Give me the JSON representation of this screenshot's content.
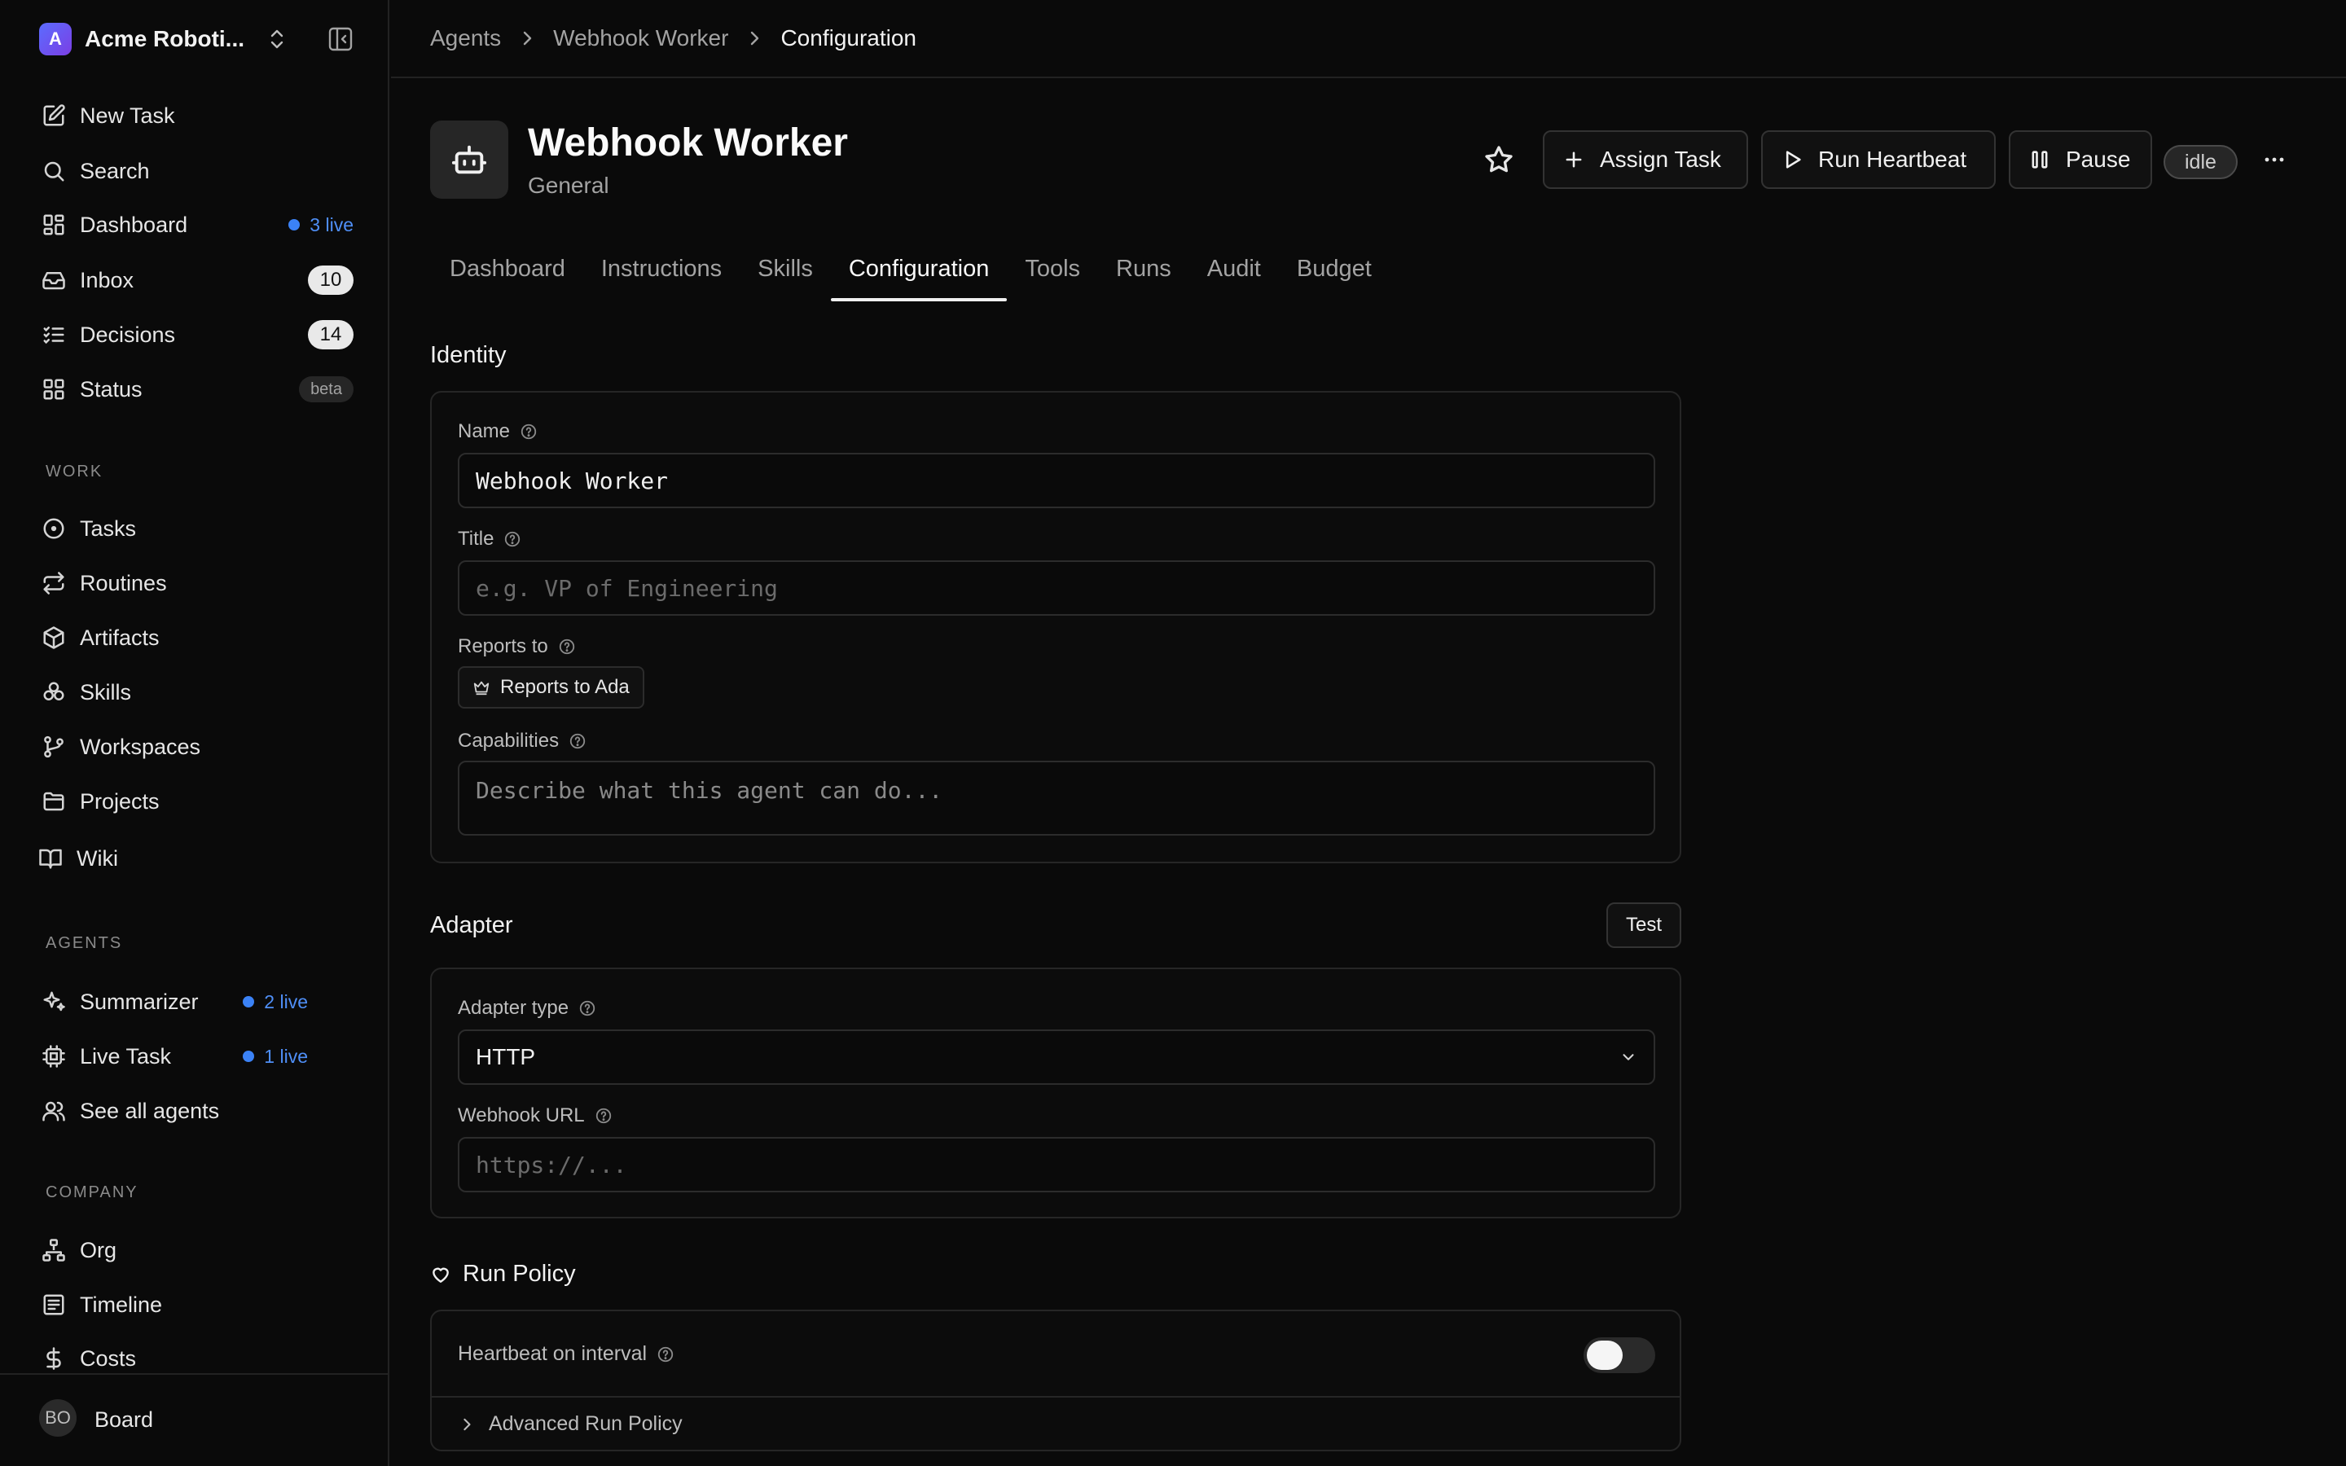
{
  "workspace": {
    "name": "Acme Roboti...",
    "logo_letter": "A"
  },
  "nav": {
    "new_task": "New Task",
    "search": "Search",
    "dashboard": "Dashboard",
    "dashboard_live": "3 live",
    "inbox": "Inbox",
    "inbox_count": "10",
    "decisions": "Decisions",
    "decisions_count": "14",
    "status": "Status",
    "status_badge": "beta"
  },
  "work": {
    "label": "WORK",
    "items": [
      "Tasks",
      "Routines",
      "Artifacts",
      "Skills",
      "Workspaces",
      "Projects",
      "Wiki"
    ]
  },
  "agents_section": {
    "label": "AGENTS",
    "summarizer": "Summarizer",
    "summarizer_live": "2 live",
    "live_task": "Live Task",
    "live_task_live": "1 live",
    "see_all": "See all agents"
  },
  "company": {
    "label": "COMPANY",
    "items": [
      "Org",
      "Timeline",
      "Costs"
    ]
  },
  "footer": {
    "avatar": "BO",
    "user": "Board"
  },
  "breadcrumb": [
    "Agents",
    "Webhook Worker",
    "Configuration"
  ],
  "agent": {
    "name": "Webhook Worker",
    "subtitle": "General",
    "status": "idle"
  },
  "actions": {
    "assign": "Assign Task",
    "heartbeat": "Run Heartbeat",
    "pause": "Pause"
  },
  "tabs": [
    "Dashboard",
    "Instructions",
    "Skills",
    "Configuration",
    "Tools",
    "Runs",
    "Audit",
    "Budget"
  ],
  "identity": {
    "title": "Identity",
    "name_label": "Name",
    "name_value": "Webhook Worker",
    "title_label": "Title",
    "title_placeholder": "e.g. VP of Engineering",
    "reports_label": "Reports to",
    "reports_value": "Reports to Ada",
    "capabilities_label": "Capabilities",
    "capabilities_placeholder": "Describe what this agent can do..."
  },
  "adapter": {
    "title": "Adapter",
    "test": "Test",
    "type_label": "Adapter type",
    "type_value": "HTTP",
    "url_label": "Webhook URL",
    "url_placeholder": "https://..."
  },
  "run_policy": {
    "title": "Run Policy",
    "heartbeat_label": "Heartbeat on interval",
    "heartbeat_enabled": false,
    "advanced": "Advanced Run Policy"
  }
}
